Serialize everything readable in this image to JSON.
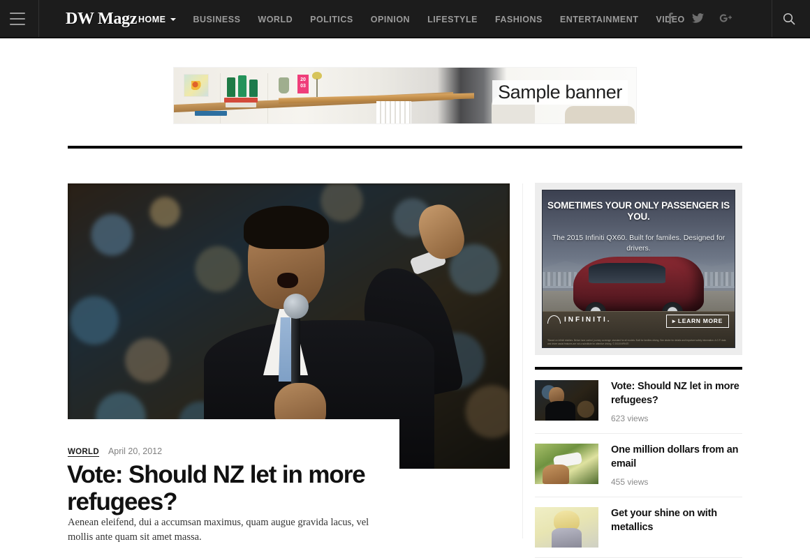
{
  "nav": {
    "brand": "DW Magz",
    "menu_icon": "hamburger-icon",
    "items": [
      {
        "label": "HOME",
        "active": true,
        "has_dropdown": true
      },
      {
        "label": "BUSINESS",
        "active": false,
        "has_dropdown": false
      },
      {
        "label": "WORLD",
        "active": false,
        "has_dropdown": false
      },
      {
        "label": "POLITICS",
        "active": false,
        "has_dropdown": false
      },
      {
        "label": "OPINION",
        "active": false,
        "has_dropdown": false
      },
      {
        "label": "LIFESTYLE",
        "active": false,
        "has_dropdown": false
      },
      {
        "label": "FASHIONS",
        "active": false,
        "has_dropdown": false
      },
      {
        "label": "ENTERTAINMENT",
        "active": false,
        "has_dropdown": false
      },
      {
        "label": "VIDEO",
        "active": false,
        "has_dropdown": false
      }
    ],
    "social": [
      {
        "name": "facebook-icon",
        "glyph": "f"
      },
      {
        "name": "twitter-icon",
        "glyph": "ᴠ"
      },
      {
        "name": "google-plus-icon",
        "glyph": "g+"
      }
    ],
    "search_icon": "search-icon",
    "bg_color": "#1c1c1c",
    "active_color": "#ffffff",
    "inactive_color": "#9b9b9b"
  },
  "banner": {
    "label": "Sample banner",
    "calendar_line1": "20",
    "calendar_line2": "03"
  },
  "article": {
    "category": "WORLD",
    "date": "April 20, 2012",
    "title": "Vote: Should NZ let in more refugees?",
    "excerpt": "Aenean eleifend, dui a accumsan maximus, quam augue gravida lacus, vel mollis ante quam sit amet massa.",
    "image_alt": "man speaking into microphone with raised hand"
  },
  "sidebar": {
    "ad": {
      "headline": "SOMETIMES YOUR ONLY PASSENGER IS YOU.",
      "subline": "The 2015 Infiniti QX60. Built for familes. Designed for drivers.",
      "brand": "INFINITI.",
      "cta": "▸ LEARN MORE",
      "fine_print": "*Based on Infiniti retailers. Before lane control, journey coverage, standard for all models. Built for families driving. See dealer for details and important safety information. A.G.P. data and driver assist features are not a substitute for attentive driving. © 2015 INFINITI"
    },
    "popular": [
      {
        "title": "Vote: Should NZ let in more refugees?",
        "views": "623 views",
        "thumb": "thumb-speaker"
      },
      {
        "title": "One million dollars from an email",
        "views": "455 views",
        "thumb": "thumb-phone-hand"
      },
      {
        "title": "Get your shine on with metallics",
        "views": "",
        "thumb": "thumb-model"
      }
    ]
  }
}
